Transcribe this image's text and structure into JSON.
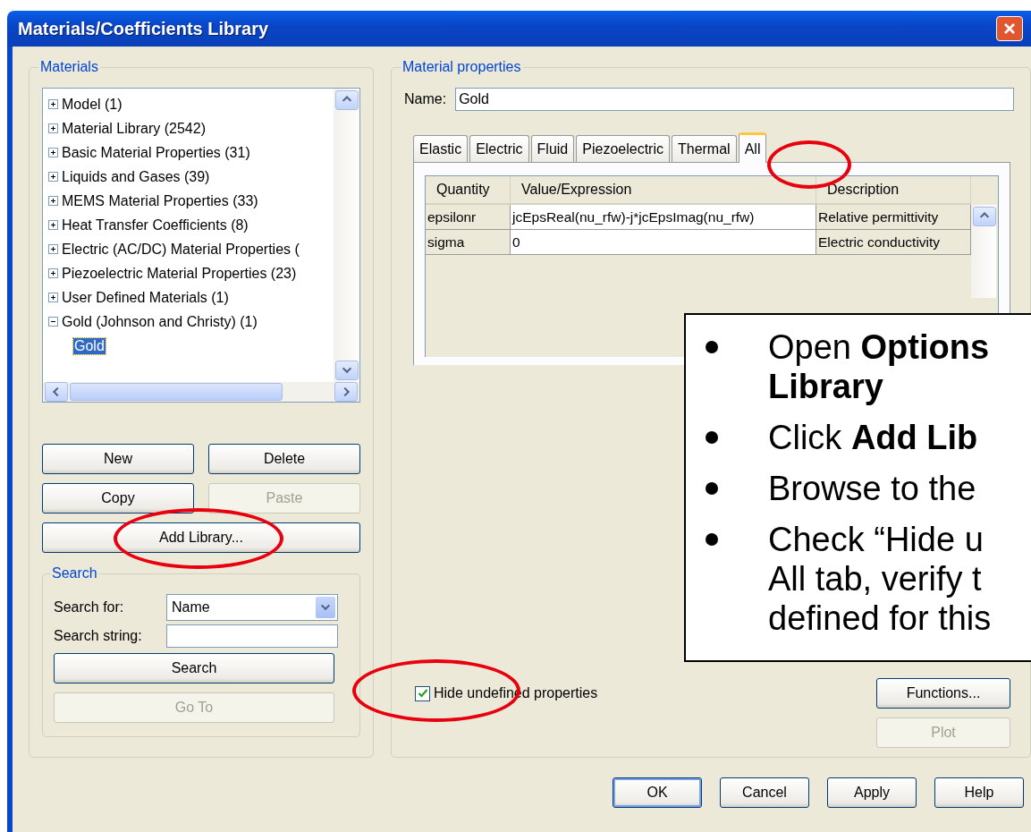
{
  "window": {
    "title": "Materials/Coefficients Library"
  },
  "materials": {
    "title": "Materials",
    "tree": [
      {
        "label": "Model (1)",
        "expanded": false,
        "selected": false
      },
      {
        "label": "Material Library (2542)",
        "expanded": false,
        "selected": false
      },
      {
        "label": "Basic Material Properties (31)",
        "expanded": false,
        "selected": false
      },
      {
        "label": "Liquids and Gases (39)",
        "expanded": false,
        "selected": false
      },
      {
        "label": "MEMS Material Properties (33)",
        "expanded": false,
        "selected": false
      },
      {
        "label": "Heat Transfer Coefficients (8)",
        "expanded": false,
        "selected": false
      },
      {
        "label": "Electric (AC/DC) Material Properties (",
        "expanded": false,
        "selected": false
      },
      {
        "label": "Piezoelectric Material Properties (23)",
        "expanded": false,
        "selected": false
      },
      {
        "label": "User Defined Materials (1)",
        "expanded": false,
        "selected": false
      },
      {
        "label": "Gold (Johnson and Christy) (1)",
        "expanded": true,
        "selected": false,
        "children": [
          {
            "label": "Gold",
            "selected": true
          }
        ]
      }
    ],
    "buttons": [
      {
        "label": "New",
        "disabled": false
      },
      {
        "label": "Delete",
        "disabled": false
      },
      {
        "label": "Copy",
        "disabled": false
      },
      {
        "label": "Paste",
        "disabled": true
      },
      {
        "label": "Add Library...",
        "disabled": false
      }
    ]
  },
  "search": {
    "title": "Search",
    "search_for_label": "Search for:",
    "search_for_value": "Name",
    "search_string_label": "Search string:",
    "buttons": [
      {
        "label": "Search",
        "disabled": false
      },
      {
        "label": "Go To",
        "disabled": true
      }
    ]
  },
  "properties": {
    "title": "Material properties",
    "name_label": "Name:",
    "name_value": "Gold",
    "tabs": [
      {
        "label": "Elastic",
        "selected": false
      },
      {
        "label": "Electric",
        "selected": false
      },
      {
        "label": "Fluid",
        "selected": false
      },
      {
        "label": "Piezoelectric",
        "selected": false
      },
      {
        "label": "Thermal",
        "selected": false
      },
      {
        "label": "All",
        "selected": true
      }
    ],
    "table": {
      "columns": [
        "Quantity",
        "Value/Expression",
        "Description"
      ],
      "rows": [
        [
          "epsilonr",
          "jcEpsReal(nu_rfw)-j*jcEpsImag(nu_rfw)",
          "Relative permittivity"
        ],
        [
          "sigma",
          "0",
          "Electric conductivity"
        ]
      ]
    },
    "hide_undefined": {
      "label": "Hide undefined properties",
      "checked": true
    },
    "side_buttons": [
      {
        "label": "Functions...",
        "disabled": false
      },
      {
        "label": "Plot",
        "disabled": true
      }
    ]
  },
  "dialog_buttons": [
    {
      "label": "OK",
      "default": true
    },
    {
      "label": "Cancel",
      "default": false
    },
    {
      "label": "Apply",
      "default": false
    },
    {
      "label": "Help",
      "default": false
    }
  ],
  "callout": {
    "bullets": [
      {
        "lines": [
          "Open **Options**",
          "**Library**"
        ]
      },
      {
        "lines": [
          "Click **Add Lib**"
        ]
      },
      {
        "lines": [
          "Browse to the"
        ]
      },
      {
        "lines": [
          "Check “Hide u",
          "All tab, verify t",
          "defined for this"
        ]
      }
    ]
  }
}
